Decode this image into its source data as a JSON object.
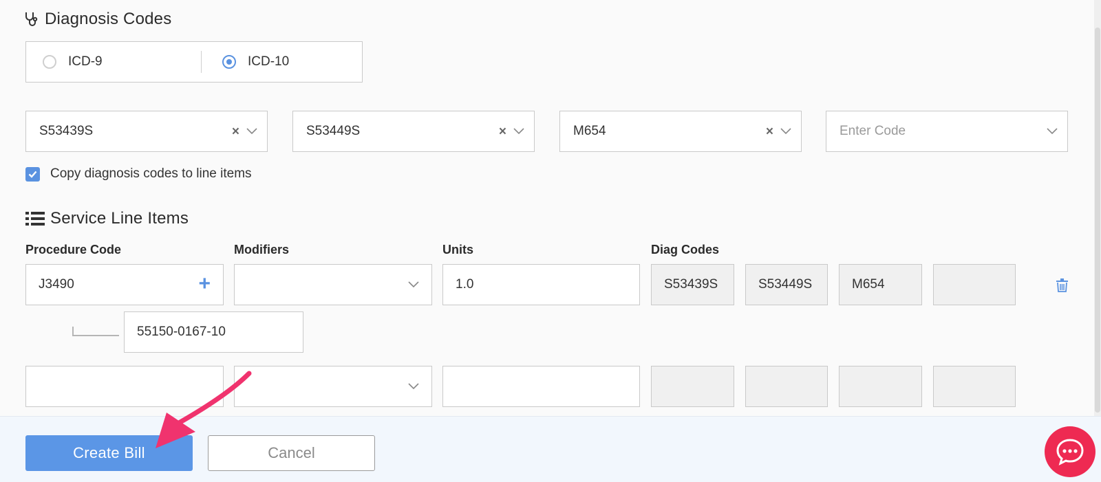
{
  "diagnosis": {
    "title": "Diagnosis Codes",
    "code_system": {
      "options": [
        "ICD-9",
        "ICD-10"
      ],
      "selected": "ICD-10"
    },
    "codes": [
      {
        "value": "S53439S",
        "clearable": true
      },
      {
        "value": "S53449S",
        "clearable": true
      },
      {
        "value": "M654",
        "clearable": true
      },
      {
        "value": "",
        "placeholder": "Enter Code",
        "clearable": false
      }
    ],
    "copy_checkbox": {
      "label": "Copy diagnosis codes to line items",
      "checked": true
    }
  },
  "service": {
    "title": "Service Line Items",
    "columns": {
      "procedure": "Procedure Code",
      "modifiers": "Modifiers",
      "units": "Units",
      "diag": "Diag Codes"
    },
    "rows": [
      {
        "procedure_code": "J3490",
        "modifiers": "",
        "units": "1.0",
        "diag_codes": [
          "S53439S",
          "S53449S",
          "M654",
          ""
        ],
        "ndc": "55150-0167-10"
      },
      {
        "procedure_code": "",
        "modifiers": "",
        "units": "",
        "diag_codes": [
          "",
          "",
          "",
          ""
        ]
      }
    ]
  },
  "footer": {
    "create_label": "Create Bill",
    "cancel_label": "Cancel"
  },
  "colors": {
    "accent": "#5b96e6",
    "chat": "#ee2a52",
    "annotation_arrow": "#f0336e"
  },
  "icons": {
    "diagnosis": "stethoscope-icon",
    "service": "list-icon",
    "delete": "trash-icon",
    "chat": "chat-icon"
  }
}
